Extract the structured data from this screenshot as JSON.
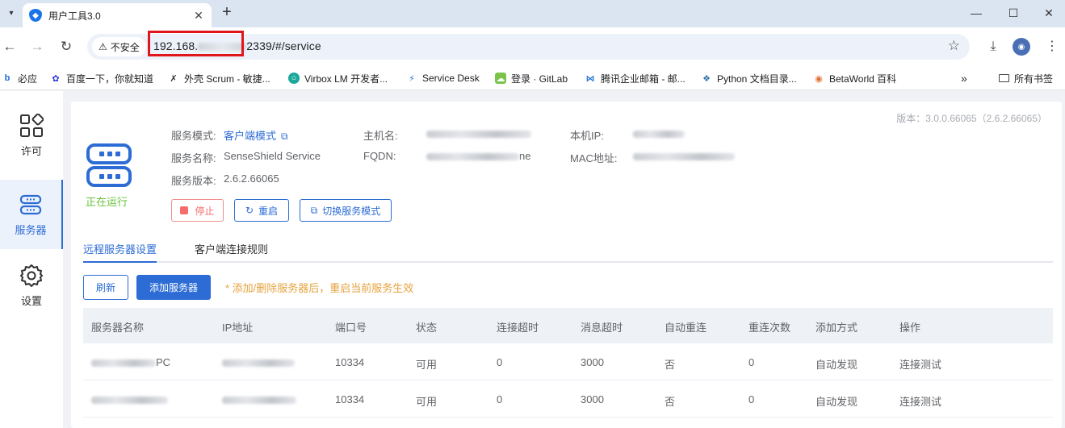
{
  "browser": {
    "tab_title": "用户工具3.0",
    "security_label": "不安全",
    "url_prefix": "192.168.",
    "url_suffix": "2339/#/service",
    "bookmarks": [
      {
        "label": "必应",
        "icon": "bing-icon"
      },
      {
        "label": "百度一下，你就知道",
        "icon": "baidu-icon"
      },
      {
        "label": "外壳 Scrum - 敏捷...",
        "icon": "scrum-icon"
      },
      {
        "label": "Virbox LM 开发者...",
        "icon": "virbox-icon"
      },
      {
        "label": "Service Desk",
        "icon": "service-desk-icon"
      },
      {
        "label": "登录 · GitLab",
        "icon": "gitlab-icon"
      },
      {
        "label": "腾讯企业邮箱 - 邮...",
        "icon": "tencent-mail-icon"
      },
      {
        "label": "Python 文档目录...",
        "icon": "python-icon"
      },
      {
        "label": "BetaWorld 百科",
        "icon": "betaworld-icon"
      }
    ],
    "all_bookmarks_label": "所有书签"
  },
  "sidebar": {
    "items": [
      {
        "label": "许可",
        "icon": "license-grid-icon"
      },
      {
        "label": "服务器",
        "icon": "server-icon"
      },
      {
        "label": "设置",
        "icon": "gear-icon"
      }
    ]
  },
  "service": {
    "version": "版本：3.0.0.66065（2.6.2.66065）",
    "status": "正在运行",
    "mode_label": "服务模式:",
    "mode_value": "客户端模式",
    "name_label": "服务名称:",
    "name_value": "SenseShield Service",
    "svc_version_label": "服务版本:",
    "svc_version_value": "2.6.2.66065",
    "hostname_label": "主机名:",
    "fqdn_label": "FQDN:",
    "fqdn_visible_tail": "ne",
    "ip_label": "本机IP:",
    "mac_label": "MAC地址:",
    "buttons": {
      "stop": "停止",
      "restart": "重启",
      "switch_mode": "切换服务模式"
    }
  },
  "tabs": [
    {
      "label": "远程服务器设置",
      "active": true
    },
    {
      "label": "客户端连接规则",
      "active": false
    }
  ],
  "actions": {
    "refresh": "刷新",
    "add_server": "添加服务器",
    "note": "* 添加/删除服务器后，重启当前服务生效"
  },
  "table": {
    "columns": [
      "服务器名称",
      "IP地址",
      "端口号",
      "状态",
      "连接超时",
      "消息超时",
      "自动重连",
      "重连次数",
      "添加方式",
      "操作"
    ],
    "rows": [
      {
        "name_tail": "PC",
        "ip_tail": "",
        "port": "10334",
        "status": "可用",
        "conn_timeout": "0",
        "msg_timeout": "3000",
        "auto_reconnect": "否",
        "reconnect_count": "0",
        "add_method": "自动发现",
        "action": "连接测试"
      },
      {
        "name_tail": "",
        "ip_tail": "",
        "port": "10334",
        "status": "可用",
        "conn_timeout": "0",
        "msg_timeout": "3000",
        "auto_reconnect": "否",
        "reconnect_count": "0",
        "add_method": "自动发现",
        "action": "连接测试"
      }
    ]
  },
  "colors": {
    "accent": "#2c6cd4",
    "running": "#67c23a",
    "danger": "#f56c6c",
    "warning_note": "#e6a23c",
    "highlight_box": "#e0161b"
  }
}
